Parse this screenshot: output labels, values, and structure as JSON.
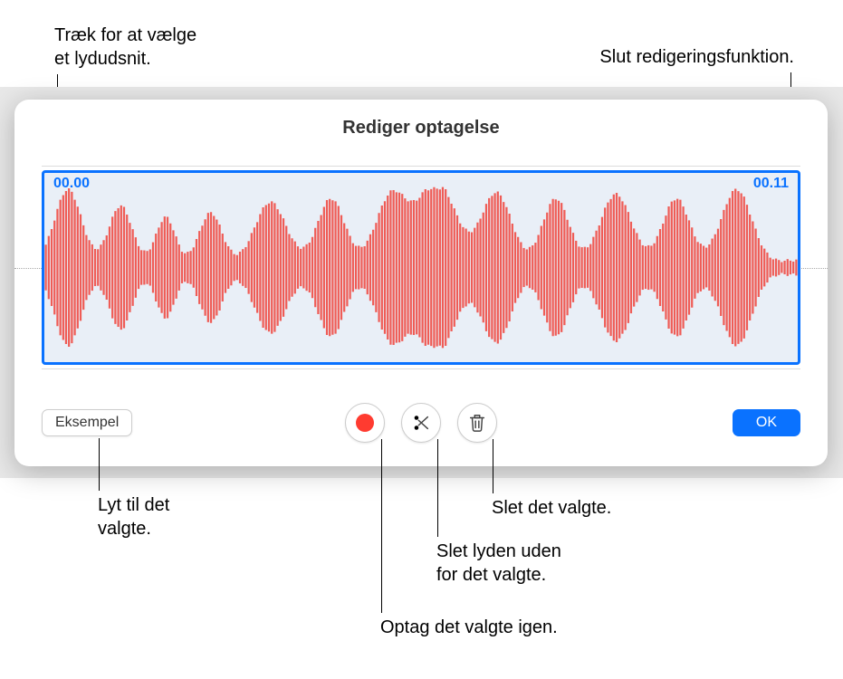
{
  "callouts": {
    "drag_select": "Træk for at vælge\net lydudsnit.",
    "exit_editing": "Slut redigeringsfunktion.",
    "preview": "Lyt til det\nvalgte.",
    "record_again": "Optag det valgte igen.",
    "trim_outside": "Slet lyden uden\nfor det valgte.",
    "delete_selected": "Slet det valgte."
  },
  "panel": {
    "title": "Rediger optagelse",
    "time_start": "00.00",
    "time_end": "00.11"
  },
  "toolbar": {
    "preview_label": "Eksempel",
    "ok_label": "OK"
  },
  "colors": {
    "accent": "#0a72ff",
    "record": "#ff3b30",
    "waveform": "#ef5c56"
  }
}
